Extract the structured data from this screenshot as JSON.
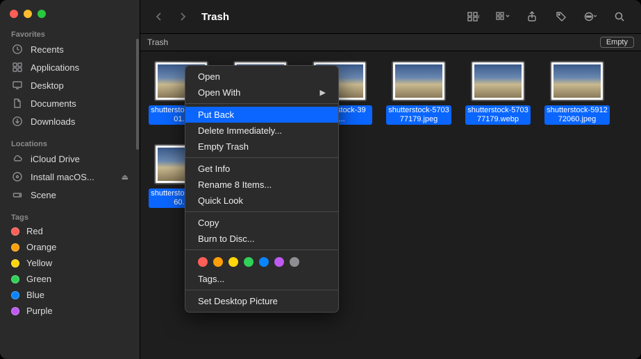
{
  "window": {
    "title": "Trash"
  },
  "pathbar": {
    "location": "Trash",
    "empty_label": "Empty"
  },
  "sidebar": {
    "favorites_label": "Favorites",
    "favorites": [
      {
        "label": "Recents",
        "icon": "clock-icon"
      },
      {
        "label": "Applications",
        "icon": "apps-icon"
      },
      {
        "label": "Desktop",
        "icon": "desktop-icon"
      },
      {
        "label": "Documents",
        "icon": "document-icon"
      },
      {
        "label": "Downloads",
        "icon": "download-icon"
      }
    ],
    "locations_label": "Locations",
    "locations": [
      {
        "label": "iCloud Drive",
        "icon": "cloud-icon"
      },
      {
        "label": "Install macOS...",
        "icon": "disc-icon",
        "eject": true
      },
      {
        "label": "Scene",
        "icon": "drive-icon"
      }
    ],
    "tags_label": "Tags",
    "tags": [
      {
        "label": "Red",
        "color": "#ff5f57"
      },
      {
        "label": "Orange",
        "color": "#ff9f0a"
      },
      {
        "label": "Yellow",
        "color": "#ffd60a"
      },
      {
        "label": "Green",
        "color": "#30d158"
      },
      {
        "label": "Blue",
        "color": "#0a84ff"
      },
      {
        "label": "Purple",
        "color": "#bf5af2"
      }
    ]
  },
  "files": {
    "row1": [
      "shutterstock-425001...",
      "shutterstock-...",
      "shutterstock-391...",
      "shutterstock-570377179.jpeg",
      "shutterstock-570377179.webp",
      "shutterstock-591272060.jpeg"
    ],
    "row2": [
      "shutterstock-272060..."
    ]
  },
  "context_menu": {
    "open": "Open",
    "open_with": "Open With",
    "put_back": "Put Back",
    "delete_immediately": "Delete Immediately...",
    "empty_trash": "Empty Trash",
    "get_info": "Get Info",
    "rename": "Rename 8 Items...",
    "quick_look": "Quick Look",
    "copy": "Copy",
    "burn": "Burn to Disc...",
    "tags": "Tags...",
    "set_desktop": "Set Desktop Picture",
    "colors": [
      "#ff5f57",
      "#ff9f0a",
      "#ffd60a",
      "#30d158",
      "#0a84ff",
      "#bf5af2",
      "#8e8e93"
    ]
  },
  "annotation": {
    "highlighted_item": "put_back"
  }
}
